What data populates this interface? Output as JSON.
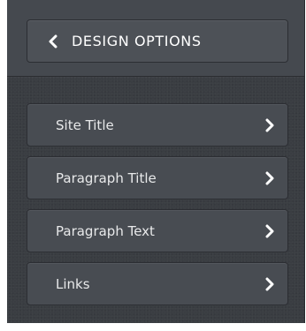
{
  "panel": {
    "back_button": {
      "label": "DESIGN OPTIONS",
      "icon": "chevron-left-icon"
    },
    "menu_items": [
      {
        "label": "Site Title",
        "icon": "chevron-right-icon"
      },
      {
        "label": "Paragraph Title",
        "icon": "chevron-right-icon"
      },
      {
        "label": "Paragraph Text",
        "icon": "chevron-right-icon"
      },
      {
        "label": "Links",
        "icon": "chevron-right-icon"
      }
    ]
  },
  "colors": {
    "panel_background": "#3a3d42",
    "button_background": "#484c52",
    "text": "#ffffff"
  }
}
